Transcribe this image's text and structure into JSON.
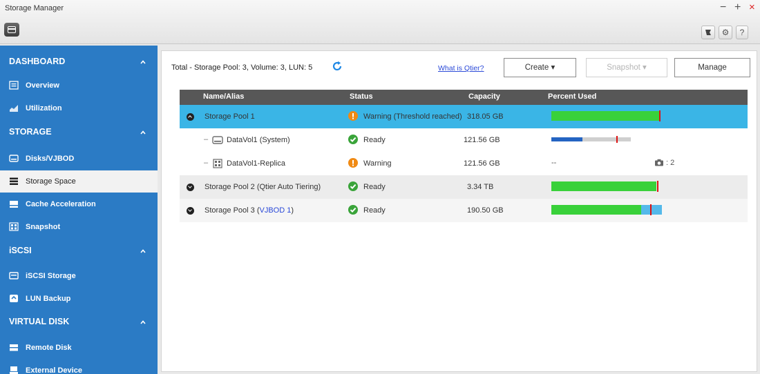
{
  "window": {
    "title": "Storage Manager",
    "controls": {
      "minimize": "−",
      "maximize": "+",
      "close": "×"
    },
    "toolbar": {
      "help_label": "?"
    }
  },
  "sidebar": {
    "sections": [
      {
        "label": "DASHBOARD",
        "items": [
          {
            "label": "Overview",
            "icon": "overview-icon"
          },
          {
            "label": "Utilization",
            "icon": "utilization-icon"
          }
        ]
      },
      {
        "label": "STORAGE",
        "items": [
          {
            "label": "Disks/VJBOD",
            "icon": "disk-icon"
          },
          {
            "label": "Storage Space",
            "icon": "storage-space-icon",
            "active": true
          },
          {
            "label": "Cache Acceleration",
            "icon": "cache-icon"
          },
          {
            "label": "Snapshot",
            "icon": "snapshot-icon"
          }
        ]
      },
      {
        "label": "iSCSI",
        "items": [
          {
            "label": "iSCSI Storage",
            "icon": "iscsi-storage-icon"
          },
          {
            "label": "LUN Backup",
            "icon": "lun-backup-icon"
          }
        ]
      },
      {
        "label": "VIRTUAL DISK",
        "items": [
          {
            "label": "Remote Disk",
            "icon": "remote-disk-icon"
          },
          {
            "label": "External Device",
            "icon": "external-device-icon"
          }
        ]
      }
    ]
  },
  "header": {
    "totals": "Total - Storage Pool: 3, Volume: 3, LUN: 5",
    "what_is_link": "What is Qtier?",
    "create_label": "Create ▾",
    "snapshot_label": "Snapshot ▾",
    "manage_label": "Manage"
  },
  "table": {
    "columns": [
      "Name/Alias",
      "Status",
      "Capacity",
      "Percent Used"
    ],
    "rows": [
      {
        "name": "Storage Pool 1",
        "status": "Warning (Threshold reached)",
        "status_type": "warning",
        "capacity": "318.05 GB",
        "used_fraction": 0.99,
        "threshold_fraction": 0.98
      },
      {
        "name": "DataVol1 (System)",
        "status": "Ready",
        "status_type": "ready",
        "capacity": "121.56 GB",
        "used_fraction": 0.33,
        "allocated_fraction": 0.85,
        "threshold_fraction": 0.7
      },
      {
        "name": "DataVol1-Replica",
        "status": "Warning",
        "status_type": "warning",
        "capacity": "121.56 GB",
        "percent_text": "--",
        "snapshot_count": ": 2"
      },
      {
        "name": "Storage Pool 2 (Qtier Auto Tiering)",
        "status": "Ready",
        "status_type": "ready",
        "capacity": "3.34 TB",
        "used_fraction": 0.97,
        "threshold_fraction": 0.98
      },
      {
        "name_prefix": "Storage Pool 3 (",
        "name_link": "VJBOD 1",
        "name_suffix": ")",
        "status": "Ready",
        "status_type": "ready",
        "capacity": "190.50 GB",
        "used_fraction": 0.81,
        "secondary_fraction": 1.0,
        "threshold_fraction": 0.9
      }
    ]
  },
  "colors": {
    "sidebar": "#2b7bc5",
    "selected_row": "#3ab5e6",
    "used_green": "#39d13a",
    "used_blue": "#2464c2",
    "extra_lightblue": "#54b9ea",
    "threshold_red": "#dd1111"
  }
}
